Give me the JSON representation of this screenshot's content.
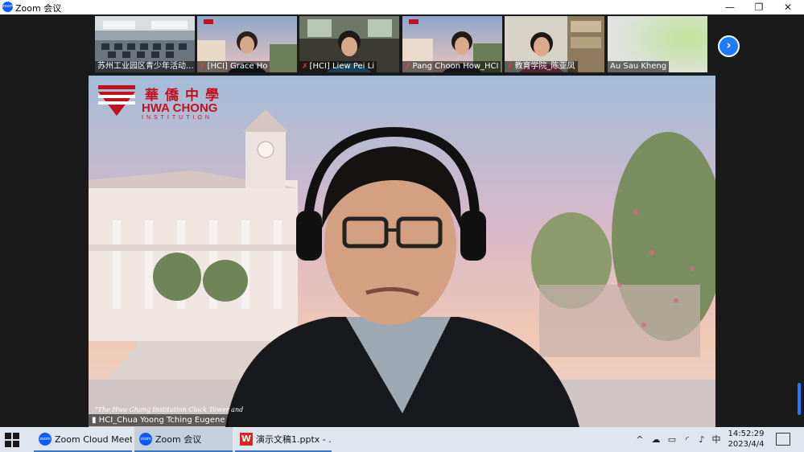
{
  "window": {
    "app_title": "Zoom 会议",
    "logo_text": "zoom",
    "minimize_glyph": "—",
    "restore_glyph": "❐",
    "close_glyph": "✕"
  },
  "gallery": {
    "participants": [
      {
        "name": "苏州工业园区青少年活动...",
        "muted": false
      },
      {
        "name": "[HCI] Grace Ho",
        "muted": true
      },
      {
        "name": "[HCI] Liew Pei Li",
        "muted": true
      },
      {
        "name": "Pang Choon How_HCI",
        "muted": true
      },
      {
        "name": "教育学院_陈亚凤",
        "muted": true
      },
      {
        "name": "Au Sau Kheng",
        "muted": false
      }
    ],
    "mute_glyph": "✗",
    "next_glyph": "›"
  },
  "main_video": {
    "brand_chinese": "華僑中學",
    "brand_english": "HWA CHONG",
    "brand_sub": "INSTITUTION",
    "caption": "\"The Hwa Chong Institution Clock Tower and",
    "speaker_name": "HCI_Chua Yoong Tching Eugene",
    "signal_glyph": "▮"
  },
  "taskbar": {
    "items": [
      {
        "label": "Zoom Cloud Meet...",
        "icon": "zoom-icon",
        "icon_text": "zoom"
      },
      {
        "label": "Zoom 会议",
        "icon": "zoom-icon",
        "icon_text": "zoom"
      },
      {
        "label": "演示文稿1.pptx - ...",
        "icon": "wps-icon",
        "icon_text": "W"
      }
    ],
    "tray": {
      "chevron": "^",
      "cloud": "☁",
      "battery": "▭",
      "wifi": "◜",
      "volume": "♪",
      "ime": "中"
    },
    "time": "14:52:29",
    "date": "2023/4/4"
  },
  "colors": {
    "zoom_blue": "#0b5cff",
    "brand_red": "#c0121f",
    "taskbar_bg": "#dfe6ee"
  }
}
